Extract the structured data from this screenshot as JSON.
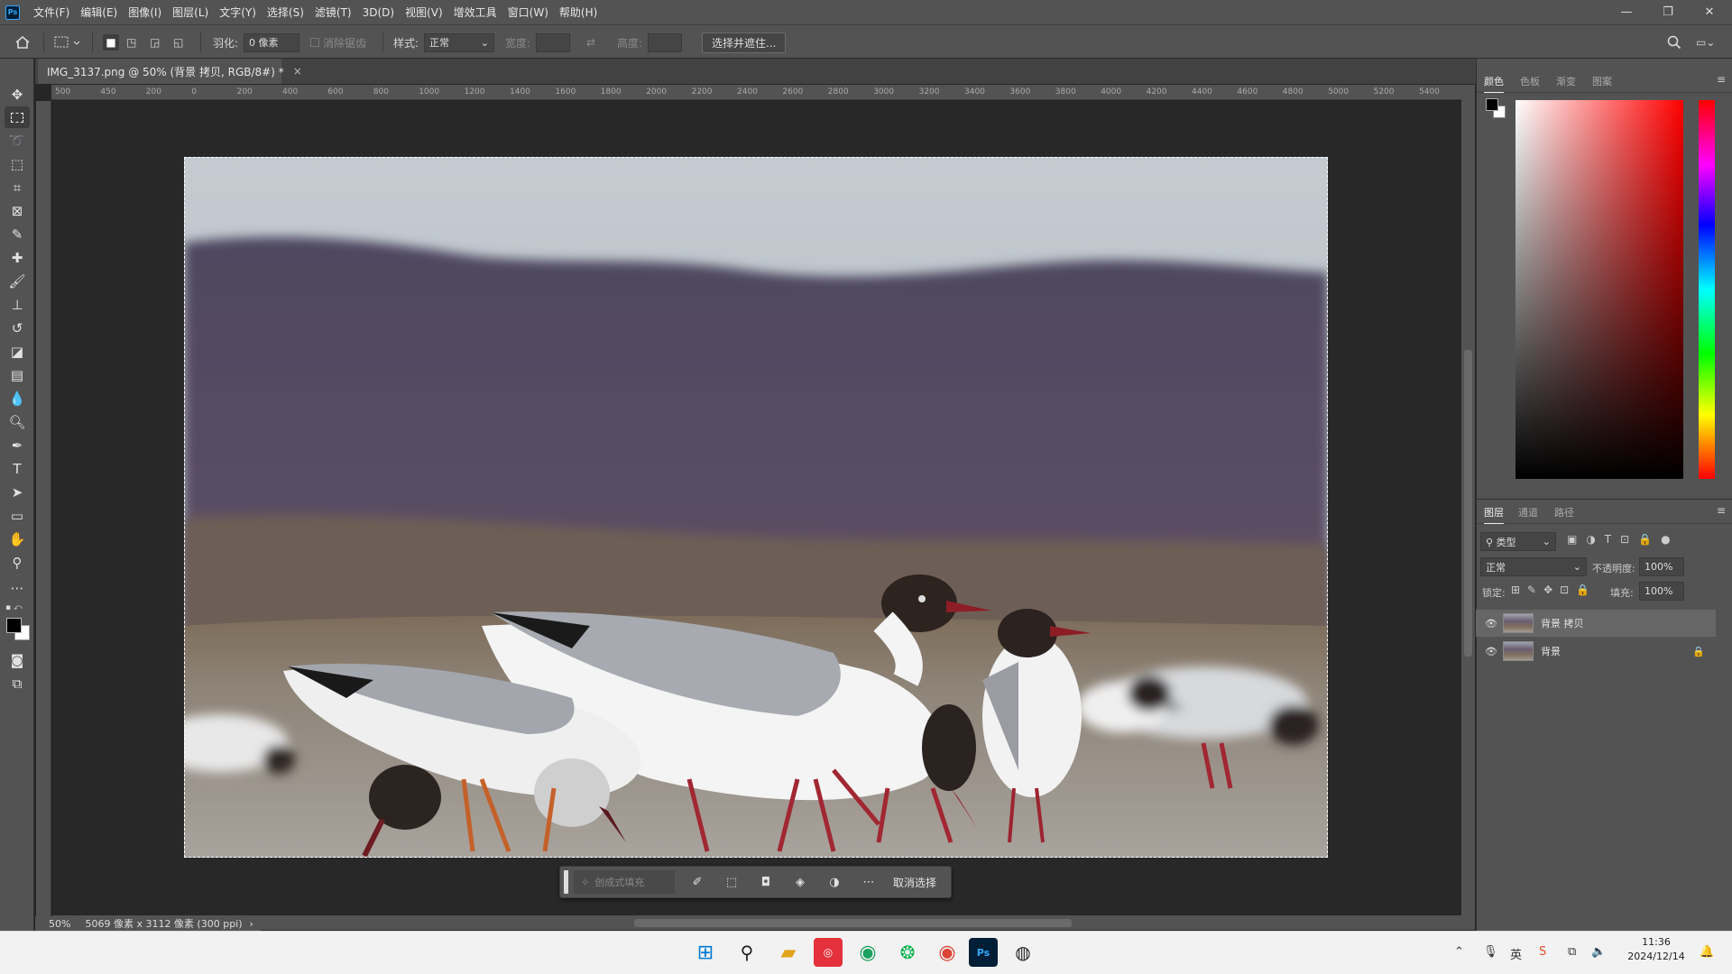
{
  "menubar": {
    "logo": "Ps",
    "items": [
      "文件(F)",
      "编辑(E)",
      "图像(I)",
      "图层(L)",
      "文字(Y)",
      "选择(S)",
      "滤镜(T)",
      "3D(D)",
      "视图(V)",
      "增效工具",
      "窗口(W)",
      "帮助(H)"
    ]
  },
  "options": {
    "feather_label": "羽化:",
    "feather_value": "0 像素",
    "antialias_label": "消除锯齿",
    "style_label": "样式:",
    "style_value": "正常",
    "width_label": "宽度:",
    "height_label": "高度:",
    "select_mask_button": "选择并遮住..."
  },
  "document": {
    "tab_title": "IMG_3137.png @ 50% (背景 拷贝, RGB/8#) *",
    "zoom": "50%",
    "info": "5069 像素 x 3112 像素 (300 ppi)"
  },
  "ruler": {
    "top_ticks": [
      "500",
      "450",
      "200",
      "0",
      "200",
      "400",
      "600",
      "800",
      "1000",
      "1200",
      "1400",
      "1600",
      "1800",
      "2000",
      "2200",
      "2400",
      "2600",
      "2800",
      "3000",
      "3200",
      "3400",
      "3600",
      "3800",
      "4000",
      "4200",
      "4400",
      "4600",
      "4800",
      "5000",
      "5200",
      "5400",
      "56"
    ]
  },
  "context_bar": {
    "generate_fill": "创成式填充",
    "deselect": "取消选择"
  },
  "color_panel": {
    "tabs": [
      "颜色",
      "色板",
      "渐变",
      "图案"
    ],
    "foreground": "#000000",
    "background": "#ffffff"
  },
  "layers_panel": {
    "tabs": [
      "图层",
      "通道",
      "路径"
    ],
    "filter_kind": "类型",
    "blend_mode": "正常",
    "opacity_label": "不透明度:",
    "opacity_value": "100%",
    "lock_label": "锁定:",
    "fill_label": "填充:",
    "fill_value": "100%",
    "layers": [
      {
        "name": "背景 拷贝",
        "selected": true,
        "locked": false
      },
      {
        "name": "背景",
        "selected": false,
        "locked": true
      }
    ]
  },
  "taskbar": {
    "time": "11:36",
    "date": "2024/12/14",
    "ime_lang": "英"
  }
}
